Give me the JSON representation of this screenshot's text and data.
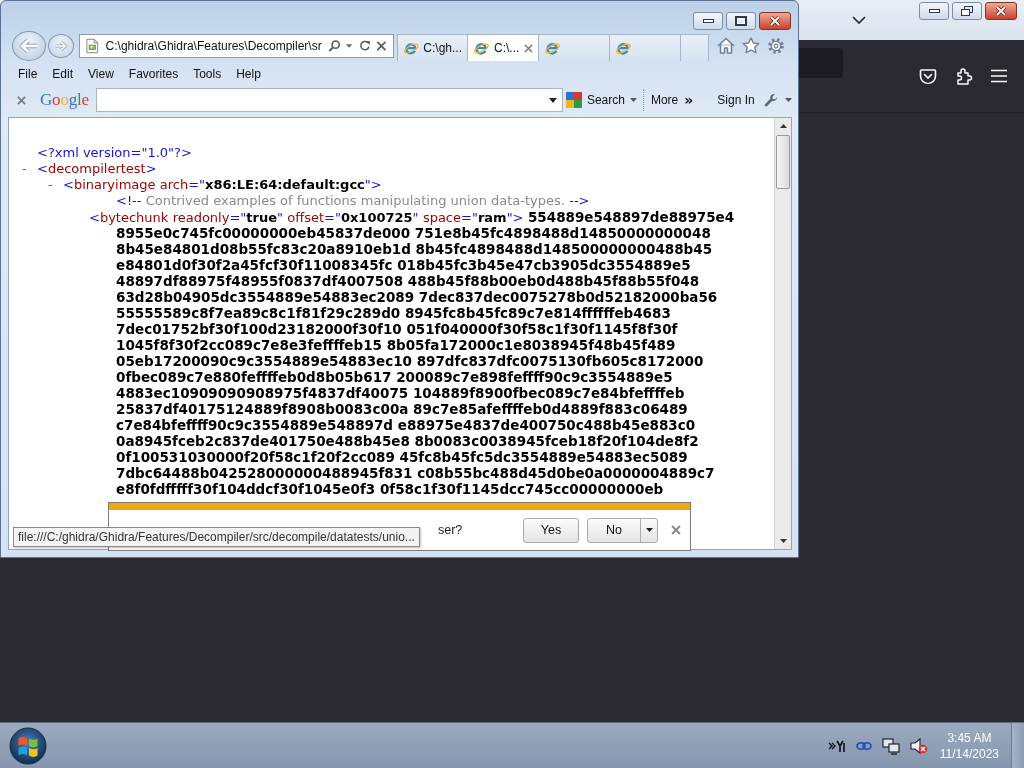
{
  "browser": {
    "address_bar": {
      "value": "C:\\ghidra\\Ghidra\\Features\\Decompiler\\sr"
    },
    "tabs": [
      {
        "title": "C:\\gh...",
        "selected": false
      },
      {
        "title": "C:\\...",
        "selected": true
      },
      {
        "selected": false
      },
      {
        "selected": false
      }
    ],
    "menu": [
      "File",
      "Edit",
      "View",
      "Favorites",
      "Tools",
      "Help"
    ],
    "google_toolbar": {
      "logo": "Google",
      "search_label": "Search",
      "more_label": "More",
      "more_chevrons": "»",
      "sign_in": "Sign In"
    },
    "document": {
      "declaration": "<?xml version=\"1.0\"?>",
      "nodes": [
        {
          "kind": "element",
          "toggle": "-",
          "expanded": true,
          "tag": [
            {
              "kind": "markup",
              "text": "<"
            },
            {
              "kind": "name",
              "text": "decompilertest"
            },
            {
              "kind": "markup",
              "text": ">"
            }
          ],
          "children": [
            {
              "kind": "element",
              "toggle": "-",
              "expanded": true,
              "tag": [
                {
                  "kind": "markup",
                  "text": "<"
                },
                {
                  "kind": "name",
                  "text": "binaryimage"
                },
                {
                  "kind": "attr",
                  "text": "arch"
                },
                {
                  "kind": "markup",
                  "text": "=\""
                },
                {
                  "kind": "value",
                  "text": "x86:LE:64:default:gcc"
                },
                {
                  "kind": "markup",
                  "text": "\">"
                }
              ],
              "children": [
                {
                  "kind": "comment",
                  "open": "<!--",
                  "text": "Contrived examples of functions manipulating union data-types.",
                  "close": "-->"
                },
                {
                  "kind": "leaf",
                  "tag": [
                    {
                      "kind": "markup",
                      "text": "<"
                    },
                    {
                      "kind": "name",
                      "text": "bytechunk"
                    },
                    {
                      "kind": "attr",
                      "text": "readonly"
                    },
                    {
                      "kind": "markup",
                      "text": "=\""
                    },
                    {
                      "kind": "value",
                      "text": "true"
                    },
                    {
                      "kind": "markup",
                      "text": "\""
                    },
                    {
                      "kind": "attr",
                      "text": "offset"
                    },
                    {
                      "kind": "markup",
                      "text": "=\""
                    },
                    {
                      "kind": "value",
                      "text": "0x100725"
                    },
                    {
                      "kind": "markup",
                      "text": "\""
                    },
                    {
                      "kind": "attr",
                      "text": "space"
                    },
                    {
                      "kind": "markup",
                      "text": "=\""
                    },
                    {
                      "kind": "value",
                      "text": "ram"
                    },
                    {
                      "kind": "markup",
                      "text": "\">"
                    }
                  ],
                  "data_lines": [
                    "554889e548897de88975e4",
                    "8955e0c745fc00000000eb45837de000 751e8b45fc4898488d14850000000048",
                    "8b45e84801d08b55fc83c20a8910eb1d 8b45fc4898488d148500000000488b45",
                    "e84801d0f30f2a45fcf30f11008345fc 018b45fc3b45e47cb3905dc3554889e5",
                    "48897df88975f48955f0837df4007508 488b45f88b00eb0d488b45f88b55f048",
                    "63d28b04905dc3554889e54883ec2089 7dec837dec0075278b0d52182000ba56",
                    "55555589c8f7ea89c8c1f81f29c289d0 8945fc8b45fc89c7e814ffffffeb4683",
                    "7dec01752bf30f100d23182000f30f10 051f040000f30f58c1f30f1145f8f30f",
                    "1045f8f30f2cc089c7e8e3feffffeb15 8b05fa172000c1e8038945f48b45f489",
                    "05eb17200090c9c3554889e54883ec10 897dfc837dfc0075130fb605c8172000",
                    "0fbec089c7e880feffffeb0d8b05b617 200089c7e898feffff90c9c3554889e5",
                    "4883ec10909090908975f4837df40075 104889f8900fbec089c7e84bfeffffeb",
                    "25837df40175124889f8908b0083c00a 89c7e85afeffffeb0d4889f883c06489",
                    "c7e84bfeffff90c9c3554889e548897d e88975e4837de400750c488b45e883c0",
                    "0a8945fceb2c837de401750e488b45e8 8b0083c0038945fceb18f20f104de8f2",
                    "0f100531030000f20f58c1f20f2cc089 45fc8b45fc5dc3554889e54883ec5089",
                    "7dbc64488b042528000000488945f831 c08b55bc488d45d0be0a0000004889c7",
                    "e8f0fdfffff30f104ddcf30f1045e0f3 0f58c1f30f1145dcc745cc00000000eb"
                  ]
                }
              ]
            }
          ]
        }
      ]
    },
    "notification": {
      "message": "ser?",
      "buttons": [
        {
          "label": "Yes",
          "kind": "plain"
        },
        {
          "label": "No",
          "kind": "split"
        }
      ]
    },
    "status_tooltip": "file:///C:/ghidra/Ghidra/Features/Decompiler/src/decompile/datatests/unio..."
  },
  "taskbar": {
    "time": "3:45 AM",
    "date": "11/14/2023"
  }
}
